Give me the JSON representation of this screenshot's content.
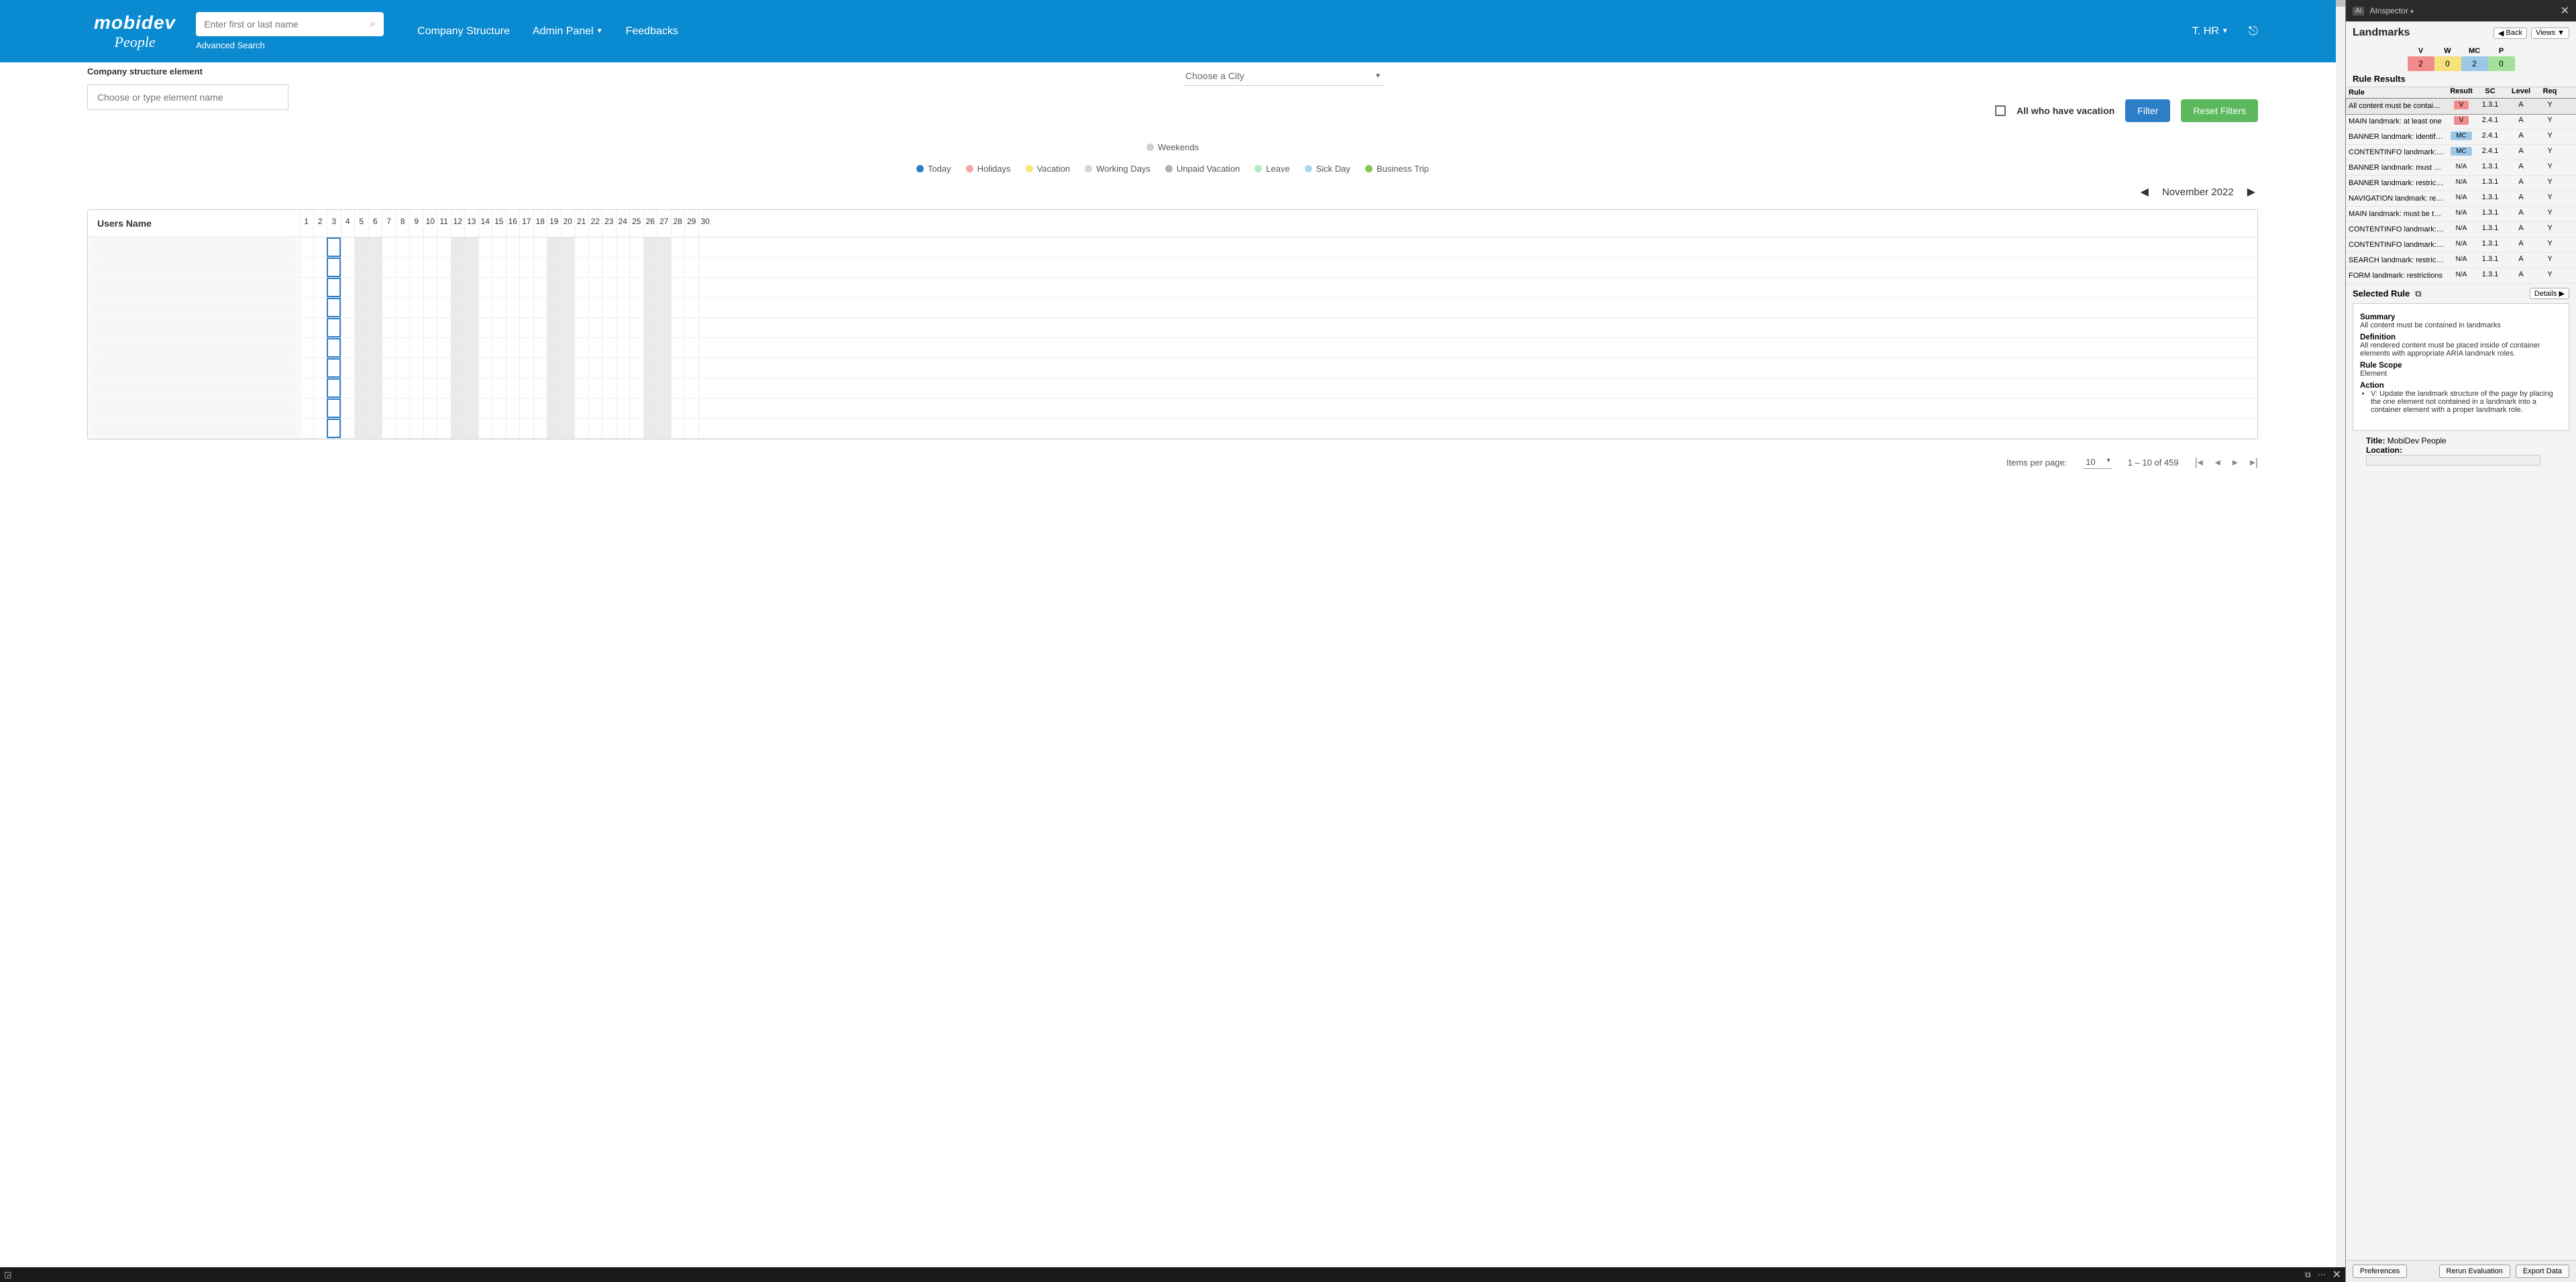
{
  "header": {
    "logo_top": "mobidev",
    "logo_bottom": "People",
    "search_placeholder": "Enter first or last name",
    "advanced_search": "Advanced Search",
    "nav": [
      "Company Structure",
      "Admin Panel",
      "Feedbacks"
    ],
    "user_label": "T. HR"
  },
  "filters": {
    "element_label": "Company structure element",
    "element_placeholder": "Choose or type element name",
    "city_placeholder": "Choose a City",
    "vacation_checkbox": "All who have vacation",
    "filter_btn": "Filter",
    "reset_btn": "Reset Filters"
  },
  "legend": [
    {
      "label": "Weekends",
      "color": "#cfcfcf"
    },
    {
      "label": "Today",
      "color": "#2c7ec7"
    },
    {
      "label": "Holidays",
      "color": "#f4a6a6"
    },
    {
      "label": "Vacation",
      "color": "#f5e27a"
    },
    {
      "label": "Working Days",
      "color": "#d6d6d6"
    },
    {
      "label": "Unpaid Vacation",
      "color": "#b0b0b0"
    },
    {
      "label": "Leave",
      "color": "#b5eac0"
    },
    {
      "label": "Sick Day",
      "color": "#a8d8f0"
    },
    {
      "label": "Business Trip",
      "color": "#7ec850"
    }
  ],
  "calendar": {
    "month": "November 2022",
    "users_header": "Users Name",
    "days": 30,
    "weekends": [
      5,
      6,
      12,
      13,
      19,
      20,
      26,
      27
    ],
    "today": 3,
    "row_count": 10
  },
  "pagination": {
    "ipp_label": "Items per page:",
    "ipp_value": "10",
    "range": "1 – 10 of 459"
  },
  "inspector": {
    "app_name": "AInspector",
    "heading": "Landmarks",
    "back": "Back",
    "views": "Views",
    "counts": {
      "V": 2,
      "W": 0,
      "MC": 2,
      "P": 0
    },
    "rule_results": "Rule Results",
    "cols": {
      "rule": "Rule",
      "result": "Result",
      "sc": "SC",
      "level": "Level",
      "req": "Req"
    },
    "rules": [
      {
        "rule": "All content must be contained ...",
        "result": "V",
        "sc": "1.3.1",
        "level": "A",
        "req": "Y"
      },
      {
        "rule": "MAIN landmark: at least one",
        "result": "V",
        "sc": "2.4.1",
        "level": "A",
        "req": "Y"
      },
      {
        "rule": "BANNER landmark: identifies b...",
        "result": "MC",
        "sc": "2.4.1",
        "level": "A",
        "req": "Y"
      },
      {
        "rule": "CONTENTINFO landmark: iden...",
        "result": "MC",
        "sc": "2.4.1",
        "level": "A",
        "req": "Y"
      },
      {
        "rule": "BANNER landmark: must be to...",
        "result": "N/A",
        "sc": "1.3.1",
        "level": "A",
        "req": "Y"
      },
      {
        "rule": "BANNER landmark: restrictions",
        "result": "N/A",
        "sc": "1.3.1",
        "level": "A",
        "req": "Y"
      },
      {
        "rule": "NAVIGATION landmark: restrict...",
        "result": "N/A",
        "sc": "1.3.1",
        "level": "A",
        "req": "Y"
      },
      {
        "rule": "MAIN landmark: must be top-l...",
        "result": "N/A",
        "sc": "1.3.1",
        "level": "A",
        "req": "Y"
      },
      {
        "rule": "CONTENTINFO landmark: mus...",
        "result": "N/A",
        "sc": "1.3.1",
        "level": "A",
        "req": "Y"
      },
      {
        "rule": "CONTENTINFO landmark: restr...",
        "result": "N/A",
        "sc": "1.3.1",
        "level": "A",
        "req": "Y"
      },
      {
        "rule": "SEARCH landmark: restrictions",
        "result": "N/A",
        "sc": "1.3.1",
        "level": "A",
        "req": "Y"
      },
      {
        "rule": "FORM landmark: restrictions",
        "result": "N/A",
        "sc": "1.3.1",
        "level": "A",
        "req": "Y"
      }
    ],
    "selected_rule": "Selected Rule",
    "details": "Details",
    "detail": {
      "summary_h": "Summary",
      "summary": "All content must be contained in landmarks",
      "definition_h": "Definition",
      "definition": "All rendered content must be placed inside of container elements with appropriate ARIA landmark roles.",
      "scope_h": "Rule Scope",
      "scope": "Element",
      "action_h": "Action",
      "action": "V: Update the landmark structure of the page by placing the one element not contained in a landmark into a container element with a proper landmark role."
    },
    "title_label": "Title:",
    "title_value": "MobiDev People",
    "location_label": "Location:",
    "footer": {
      "prefs": "Preferences",
      "rerun": "Rerun Evaluation",
      "export": "Export Data"
    }
  }
}
